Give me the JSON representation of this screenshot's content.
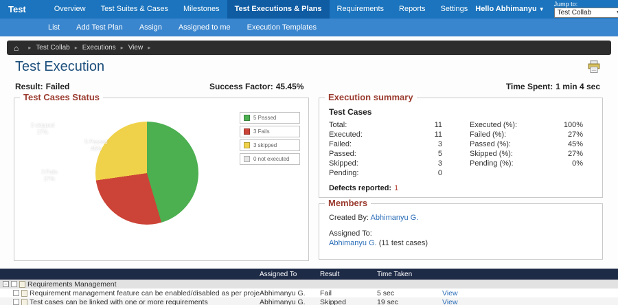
{
  "topnav": {
    "brand": "Test Collab",
    "items": [
      "Overview",
      "Test Suites & Cases",
      "Milestones",
      "Test Executions & Plans",
      "Requirements",
      "Reports",
      "Settings"
    ],
    "greeting": "Hello Abhimanyu",
    "jump_label": "Jump to:",
    "jump_value": "Test Collab"
  },
  "subnav": {
    "items": [
      "List",
      "Add Test Plan",
      "Assign",
      "Assigned to me",
      "Execution Templates"
    ]
  },
  "breadcrumb": {
    "items": [
      "Test Collab",
      "Executions",
      "View"
    ]
  },
  "page": {
    "title": "Test Execution",
    "result_label": "Result:",
    "result_value": "Failed",
    "success_label": "Success Factor:",
    "success_value": "45.45%",
    "time_label": "Time Spent:",
    "time_value": "1 min 4 sec"
  },
  "chart_data": {
    "type": "pie",
    "title": "Test Cases Status",
    "labels": [
      "5 Passed",
      "3 Fails",
      "3 skipped",
      "0 not executed"
    ],
    "counts": [
      5,
      3,
      3,
      0
    ],
    "values_percent": [
      "45%",
      "27%",
      "27%",
      "0%"
    ],
    "colors": [
      "#4caf50",
      "#cc4437",
      "#f0d24a",
      "#e6e6e6"
    ],
    "legend_position": "right"
  },
  "summary": {
    "title": "Execution summary",
    "section": "Test Cases",
    "left": [
      {
        "label": "Total:",
        "value": "11"
      },
      {
        "label": "Executed:",
        "value": "11"
      },
      {
        "label": "Failed:",
        "value": "3"
      },
      {
        "label": "Passed:",
        "value": "5"
      },
      {
        "label": "Skipped:",
        "value": "3"
      },
      {
        "label": "Pending:",
        "value": "0"
      }
    ],
    "right": [
      {
        "label": "Executed (%):",
        "value": "100%"
      },
      {
        "label": "Failed (%):",
        "value": "27%"
      },
      {
        "label": "Passed (%):",
        "value": "45%"
      },
      {
        "label": "Skipped (%):",
        "value": "27%"
      },
      {
        "label": "Pending (%):",
        "value": "0%"
      }
    ],
    "defects_label": "Defects reported:",
    "defects_value": "1"
  },
  "members": {
    "title": "Members",
    "created_label": "Created By:",
    "created_value": "Abhimanyu G.",
    "assigned_label": "Assigned To:",
    "assigned_value": "Abhimanyu G.",
    "assigned_suffix": "(11 test cases)"
  },
  "table": {
    "headers": [
      "Assigned To",
      "Result",
      "Time Taken"
    ],
    "group_row": {
      "name": "Requirements Management"
    },
    "rows": [
      {
        "name": "Requirement management feature can be enabled/disabled as per project configur",
        "assigned": "Abhimanyu G.",
        "result": "Fail",
        "time": "5 sec",
        "action": "View"
      },
      {
        "name": "Test cases can be linked with one or more requirements",
        "assigned": "Abhimanyu G.",
        "result": "Skipped",
        "time": "19 sec",
        "action": "View"
      }
    ]
  },
  "colors": {
    "accent_blue": "#1b74bd",
    "subnav_blue": "#3a86ce",
    "table_header_navy": "#1e2b47",
    "fieldset_legend": "#9a3b2f",
    "link": "#2a6db8"
  }
}
